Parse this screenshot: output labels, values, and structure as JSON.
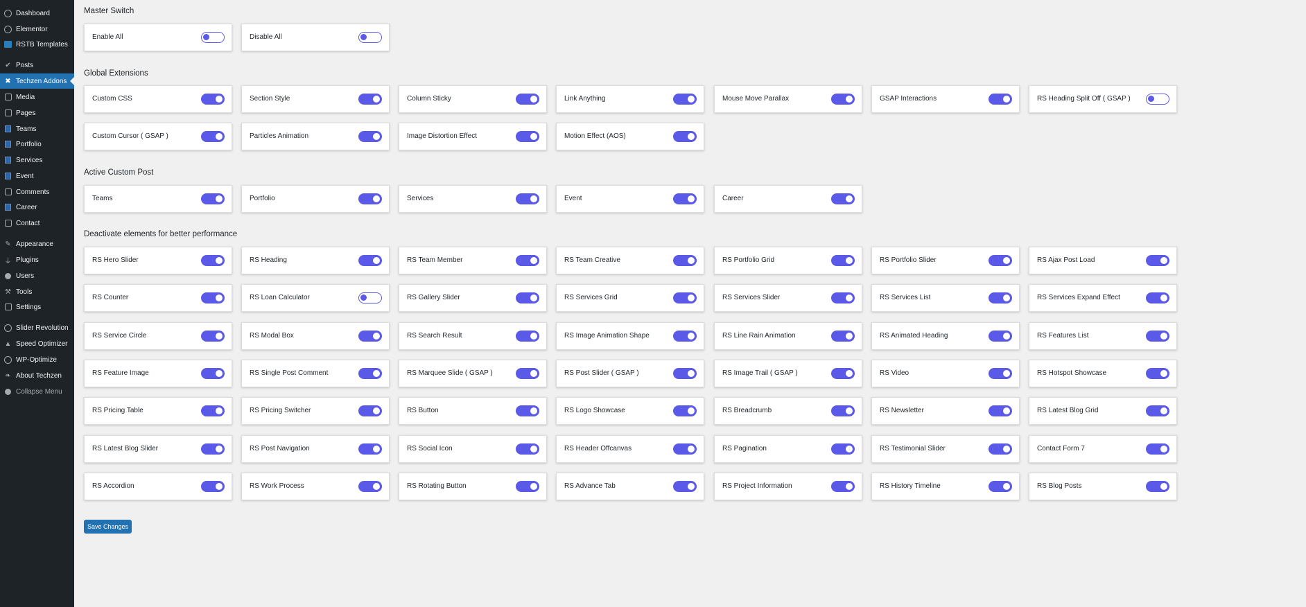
{
  "sidebar": {
    "items": [
      {
        "label": "Dashboard",
        "icon": "dashboard-icon"
      },
      {
        "label": "Elementor",
        "icon": "elementor-icon"
      },
      {
        "label": "RSTB Templates",
        "icon": "templates-icon"
      },
      {
        "label": "Posts",
        "icon": "pin-icon"
      },
      {
        "label": "Techzen Addons",
        "icon": "techzen-icon",
        "active": true
      },
      {
        "label": "Media",
        "icon": "media-icon"
      },
      {
        "label": "Pages",
        "icon": "pages-icon"
      },
      {
        "label": "Teams",
        "icon": "post-type-icon"
      },
      {
        "label": "Portfolio",
        "icon": "post-type-icon"
      },
      {
        "label": "Services",
        "icon": "post-type-icon"
      },
      {
        "label": "Event",
        "icon": "post-type-icon"
      },
      {
        "label": "Comments",
        "icon": "comments-icon"
      },
      {
        "label": "Career",
        "icon": "post-type-icon"
      },
      {
        "label": "Contact",
        "icon": "mail-icon"
      },
      {
        "label": "Appearance",
        "icon": "brush-icon"
      },
      {
        "label": "Plugins",
        "icon": "plugin-icon"
      },
      {
        "label": "Users",
        "icon": "user-icon"
      },
      {
        "label": "Tools",
        "icon": "wrench-icon"
      },
      {
        "label": "Settings",
        "icon": "settings-icon"
      },
      {
        "label": "Slider Revolution",
        "icon": "slider-revolution-icon"
      },
      {
        "label": "Speed Optimizer",
        "icon": "speed-icon"
      },
      {
        "label": "WP-Optimize",
        "icon": "optimize-icon"
      },
      {
        "label": "About Techzen",
        "icon": "info-icon"
      },
      {
        "label": "Collapse Menu",
        "icon": "collapse-icon"
      }
    ]
  },
  "colors": {
    "sidebar_bg": "#1d2327",
    "active_menu": "#2271b1",
    "toggle_accent": "#5b59e8",
    "page_bg": "#f0f0f1",
    "save_button": "#2271b1"
  },
  "sections": [
    {
      "title": "Master Switch",
      "items": [
        {
          "label": "Enable All",
          "on": false
        },
        {
          "label": "Disable All",
          "on": false
        }
      ]
    },
    {
      "title": "Global Extensions",
      "items": [
        {
          "label": "Custom CSS",
          "on": true
        },
        {
          "label": "Section Style",
          "on": true
        },
        {
          "label": "Column Sticky",
          "on": true
        },
        {
          "label": "Link Anything",
          "on": true
        },
        {
          "label": "Mouse Move Parallax",
          "on": true
        },
        {
          "label": "GSAP Interactions",
          "on": true
        },
        {
          "label": "RS Heading Split Off ( GSAP )",
          "on": false
        },
        {
          "label": "Custom Cursor ( GSAP )",
          "on": true
        },
        {
          "label": "Particles Animation",
          "on": true
        },
        {
          "label": "Image Distortion Effect",
          "on": true
        },
        {
          "label": "Motion Effect (AOS)",
          "on": true
        }
      ]
    },
    {
      "title": "Active Custom Post",
      "items": [
        {
          "label": "Teams",
          "on": true
        },
        {
          "label": "Portfolio",
          "on": true
        },
        {
          "label": "Services",
          "on": true
        },
        {
          "label": "Event",
          "on": true
        },
        {
          "label": "Career",
          "on": true
        }
      ]
    },
    {
      "title": "Deactivate elements for better performance",
      "items": [
        {
          "label": "RS Hero Slider",
          "on": true
        },
        {
          "label": "RS Heading",
          "on": true
        },
        {
          "label": "RS Team Member",
          "on": true
        },
        {
          "label": "RS Team Creative",
          "on": true
        },
        {
          "label": "RS Portfolio Grid",
          "on": true
        },
        {
          "label": "RS Portfolio Slider",
          "on": true
        },
        {
          "label": "RS Ajax Post Load",
          "on": true
        },
        {
          "label": "RS Counter",
          "on": true
        },
        {
          "label": "RS Loan Calculator",
          "on": false
        },
        {
          "label": "RS Gallery Slider",
          "on": true
        },
        {
          "label": "RS Services Grid",
          "on": true
        },
        {
          "label": "RS Services Slider",
          "on": true
        },
        {
          "label": "RS Services List",
          "on": true
        },
        {
          "label": "RS Services Expand Effect",
          "on": true
        },
        {
          "label": "RS Service Circle",
          "on": true
        },
        {
          "label": "RS Modal Box",
          "on": true
        },
        {
          "label": "RS Search Result",
          "on": true
        },
        {
          "label": "RS Image Animation Shape",
          "on": true
        },
        {
          "label": "RS Line Rain Animation",
          "on": true
        },
        {
          "label": "RS Animated Heading",
          "on": true
        },
        {
          "label": "RS Features List",
          "on": true
        },
        {
          "label": "RS Feature Image",
          "on": true
        },
        {
          "label": "RS Single Post Comment",
          "on": true
        },
        {
          "label": "RS Marquee Slide ( GSAP )",
          "on": true
        },
        {
          "label": "RS Post Slider ( GSAP )",
          "on": true
        },
        {
          "label": "RS Image Trail ( GSAP )",
          "on": true
        },
        {
          "label": "RS Video",
          "on": true
        },
        {
          "label": "RS Hotspot Showcase",
          "on": true
        },
        {
          "label": "RS Pricing Table",
          "on": true
        },
        {
          "label": "RS Pricing Switcher",
          "on": true
        },
        {
          "label": "RS Button",
          "on": true
        },
        {
          "label": "RS Logo Showcase",
          "on": true
        },
        {
          "label": "RS Breadcrumb",
          "on": true
        },
        {
          "label": "RS Newsletter",
          "on": true
        },
        {
          "label": "RS Latest Blog Grid",
          "on": true
        },
        {
          "label": "RS Latest Blog Slider",
          "on": true
        },
        {
          "label": "RS Post Navigation",
          "on": true
        },
        {
          "label": "RS Social Icon",
          "on": true
        },
        {
          "label": "RS Header Offcanvas",
          "on": true
        },
        {
          "label": "RS Pagination",
          "on": true
        },
        {
          "label": "RS Testimonial Slider",
          "on": true
        },
        {
          "label": "Contact Form 7",
          "on": true
        },
        {
          "label": "RS Accordion",
          "on": true
        },
        {
          "label": "RS Work Process",
          "on": true
        },
        {
          "label": "RS Rotating Button",
          "on": true
        },
        {
          "label": "RS Advance Tab",
          "on": true
        },
        {
          "label": "RS Project Information",
          "on": true
        },
        {
          "label": "RS History Timeline",
          "on": true
        },
        {
          "label": "RS Blog Posts",
          "on": true
        }
      ]
    }
  ],
  "save_label": "Save Changes"
}
